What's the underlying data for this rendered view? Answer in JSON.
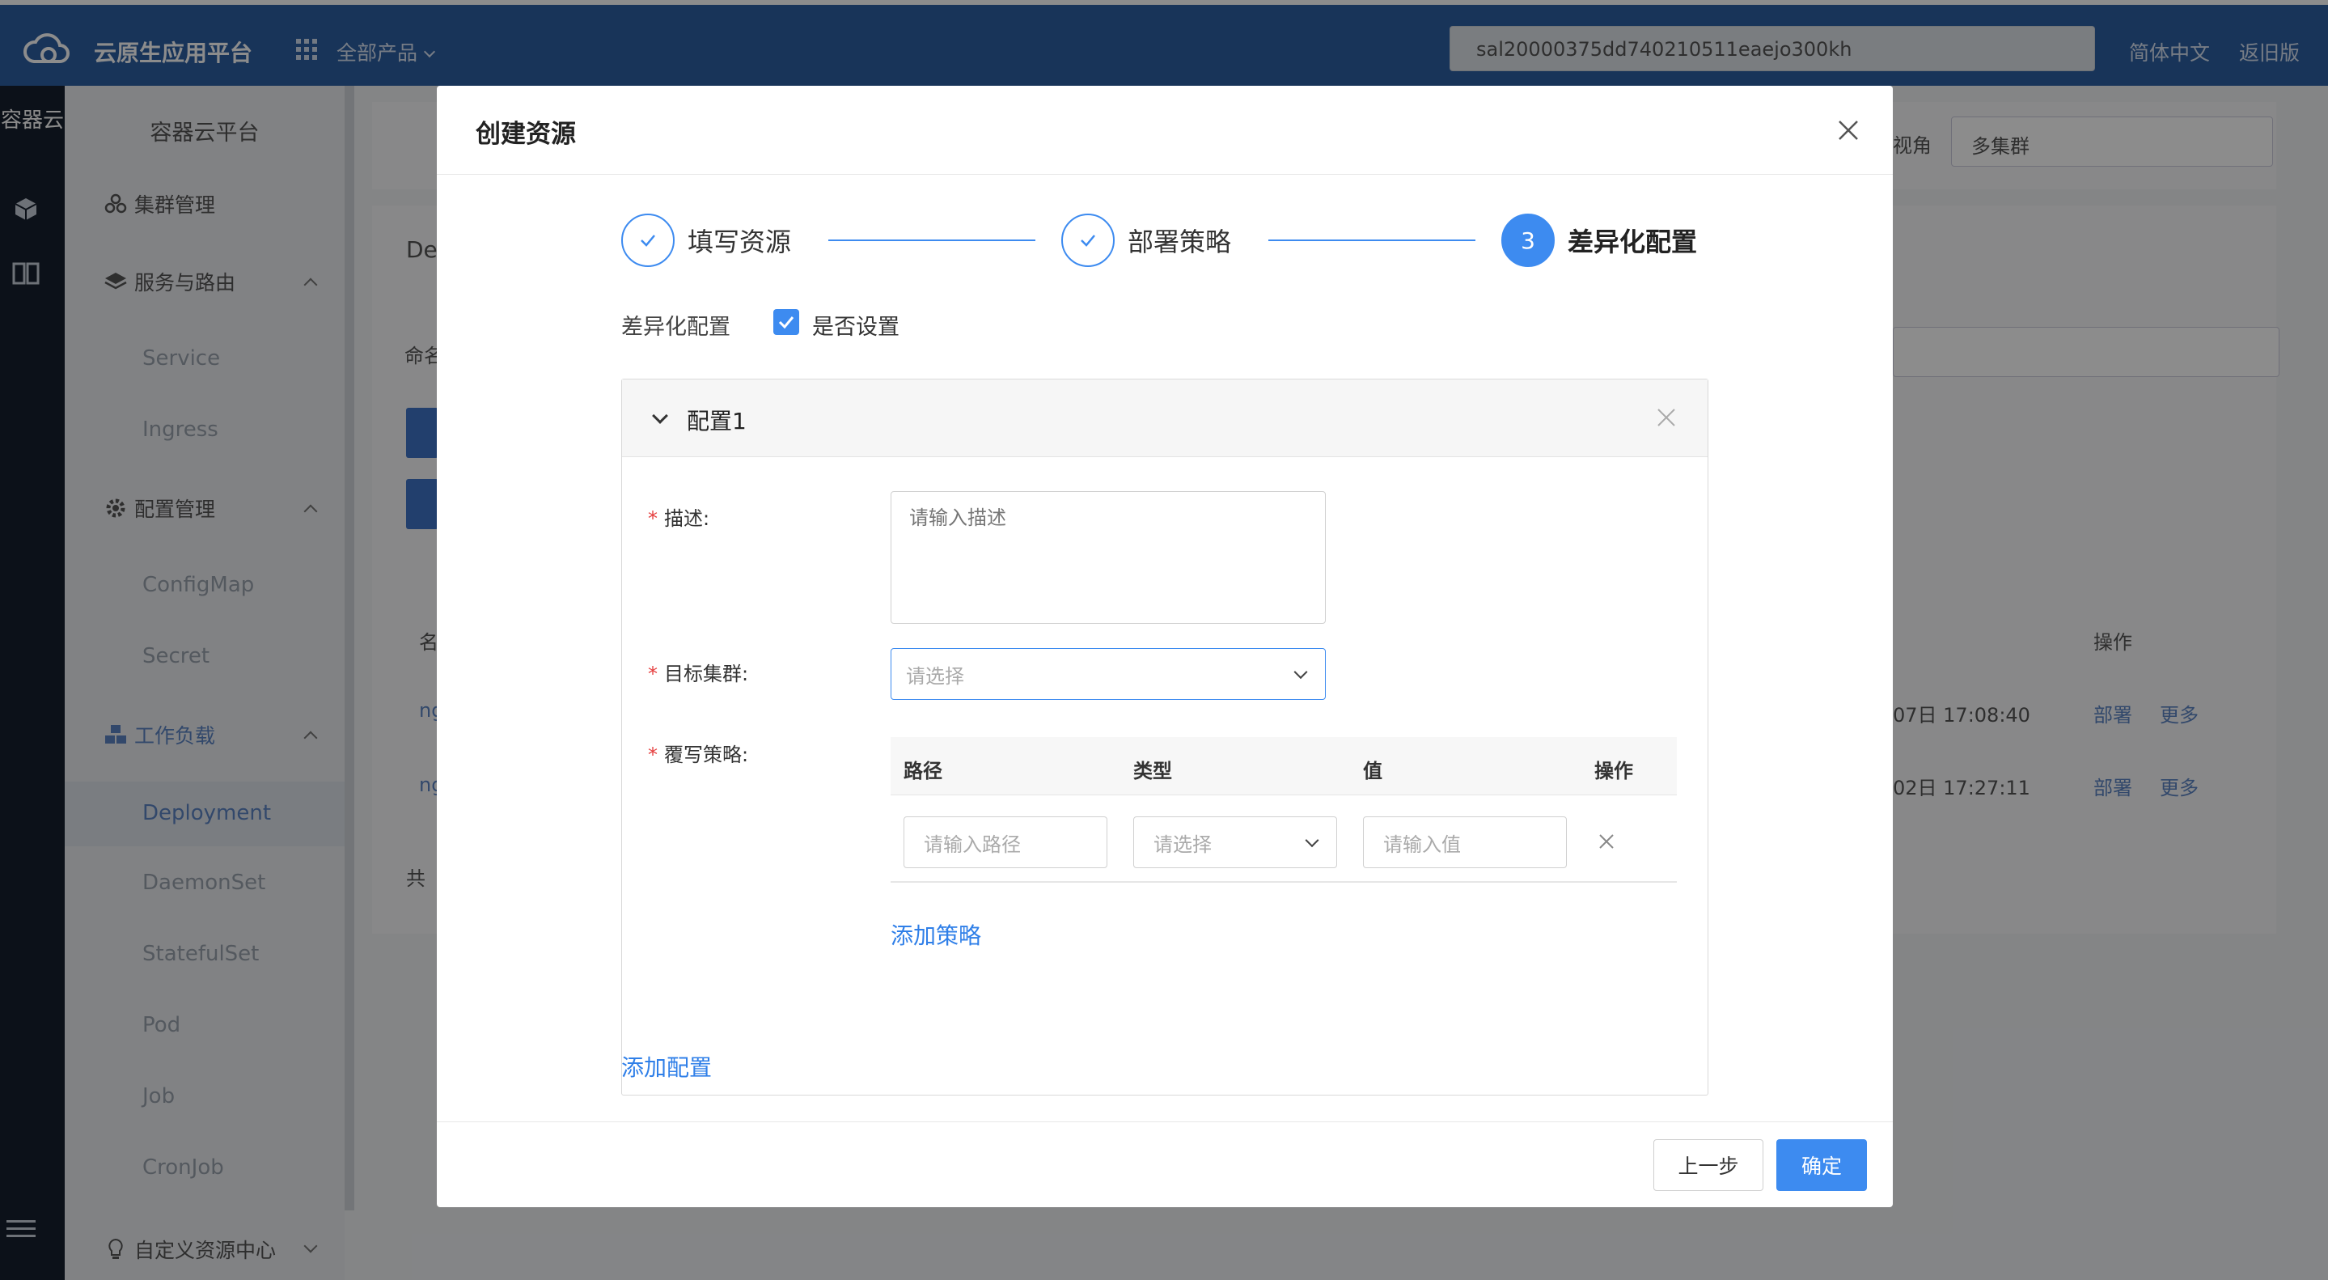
{
  "topbar": {
    "brand": "云原生应用平台",
    "products": "全部产品",
    "search_value": "sal20000375dd740210511eaejo300kh",
    "lang": "简体中文",
    "old_version": "返旧版"
  },
  "rail": {
    "title": "容器云"
  },
  "sidenav": {
    "title": "容器云平台",
    "cluster": "集群管理",
    "service_route": "服务与路由",
    "service": "Service",
    "ingress": "Ingress",
    "config_mgmt": "配置管理",
    "configmap": "ConfigMap",
    "secret": "Secret",
    "workload": "工作负载",
    "deployment": "Deployment",
    "daemonset": "DaemonSet",
    "statefulset": "StatefulSet",
    "pod": "Pod",
    "job": "Job",
    "cronjob": "CronJob",
    "crd": "自定义资源中心"
  },
  "background": {
    "view_label": "视角",
    "view_value": "多集群",
    "de": "De",
    "ns": "命名",
    "name_col": "名",
    "ng1": "ng",
    "ng2": "ng",
    "total": "共",
    "op_col": "操作",
    "time1": "07日 17:08:40",
    "time2": "02日 17:27:11",
    "deploy": "部署",
    "more": "更多"
  },
  "modal": {
    "title": "创建资源",
    "steps": [
      {
        "label": "填写资源"
      },
      {
        "label": "部署策略"
      },
      {
        "number": "3",
        "label": "差异化配置"
      }
    ],
    "diff_label": "差异化配置",
    "checkbox_label": "是否设置",
    "panel_title": "配置1",
    "desc_label": "描述:",
    "desc_placeholder": "请输入描述",
    "cluster_label": "目标集群:",
    "cluster_placeholder": "请选择",
    "policy_label": "覆写策略:",
    "table_headers": [
      "路径",
      "类型",
      "值",
      "操作"
    ],
    "path_placeholder": "请输入路径",
    "type_placeholder": "请选择",
    "value_placeholder": "请输入值",
    "add_policy": "添加策略",
    "add_config": "添加配置",
    "btn_prev": "上一步",
    "btn_ok": "确定"
  }
}
